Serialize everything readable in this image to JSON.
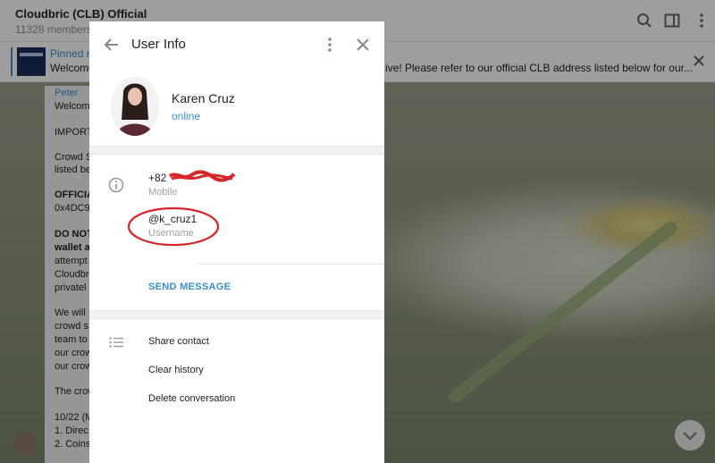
{
  "chat": {
    "title": "Cloudbric (CLB) Official",
    "members": "11328 members",
    "pinned_title": "Pinned m",
    "pinned_text_left": "Welcome",
    "pinned_text_right": "ive! Please refer to our official CLB address listed below for our...",
    "message_lines": [
      "Peter",
      "Welcom",
      "IMPORT",
      "Crowd S",
      "listed be",
      "OFFICIA",
      "0x4DC9",
      "DO NOT",
      "wallet a",
      "attempt",
      "Cloudbri",
      "privatel",
      "We will",
      "crowd s",
      "team to",
      "our crow",
      "our crow",
      "The crow",
      "10/22 (M",
      "1. Direc",
      "2. Coins"
    ]
  },
  "modal": {
    "title": "User Info",
    "name": "Karen Cruz",
    "status": "online",
    "phone_prefix": "+82",
    "phone_label": "Mobile",
    "username": "@k_cruz1",
    "username_label": "Username",
    "send_message": "SEND MESSAGE",
    "menu": [
      "Share contact",
      "Clear history",
      "Delete conversation"
    ]
  },
  "colors": {
    "accent": "#3a8fd0",
    "annotation": "#d7262b"
  }
}
